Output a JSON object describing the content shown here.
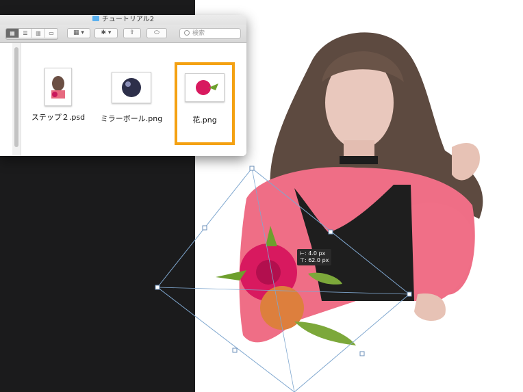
{
  "window": {
    "title": "チュートリアル2",
    "search_placeholder": "検索"
  },
  "files": [
    {
      "name": "ステップ２.psd",
      "icon": "portrait-thumbnail"
    },
    {
      "name": "ミラーボール.png",
      "icon": "mirror-ball-thumbnail"
    },
    {
      "name": "花.png",
      "icon": "flower-thumbnail",
      "selected": true
    }
  ],
  "transform_readout": {
    "line1": "⊢:  4.0 px",
    "line2": "⊤: 62.0 px"
  },
  "colors": {
    "selection": "#f4a112",
    "canvas_dark": "#1b1b1c",
    "transform_box": "#7fa7cf"
  }
}
